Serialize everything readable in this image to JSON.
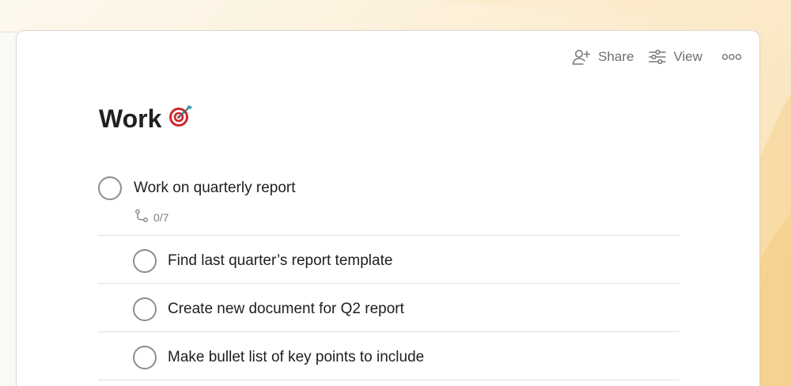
{
  "toolbar": {
    "share_label": "Share",
    "view_label": "View"
  },
  "page": {
    "title": "Work",
    "title_emoji": "🎯"
  },
  "tasks": [
    {
      "label": "Work on quarterly report",
      "subtask_count": "0/7",
      "subtasks": [
        {
          "label": "Find last quarter’s report template"
        },
        {
          "label": "Create new document for Q2 report"
        },
        {
          "label": "Make bullet list of key points to include"
        }
      ]
    }
  ],
  "colors": {
    "background_warm": "#fcefd6",
    "card": "#ffffff",
    "checkbox_border": "#8d8d8d",
    "text_primary": "#202020",
    "text_muted": "#707070"
  },
  "icons": [
    "add-person-icon",
    "sliders-icon",
    "more-icon",
    "subtask-icon",
    "target-emoji"
  ]
}
